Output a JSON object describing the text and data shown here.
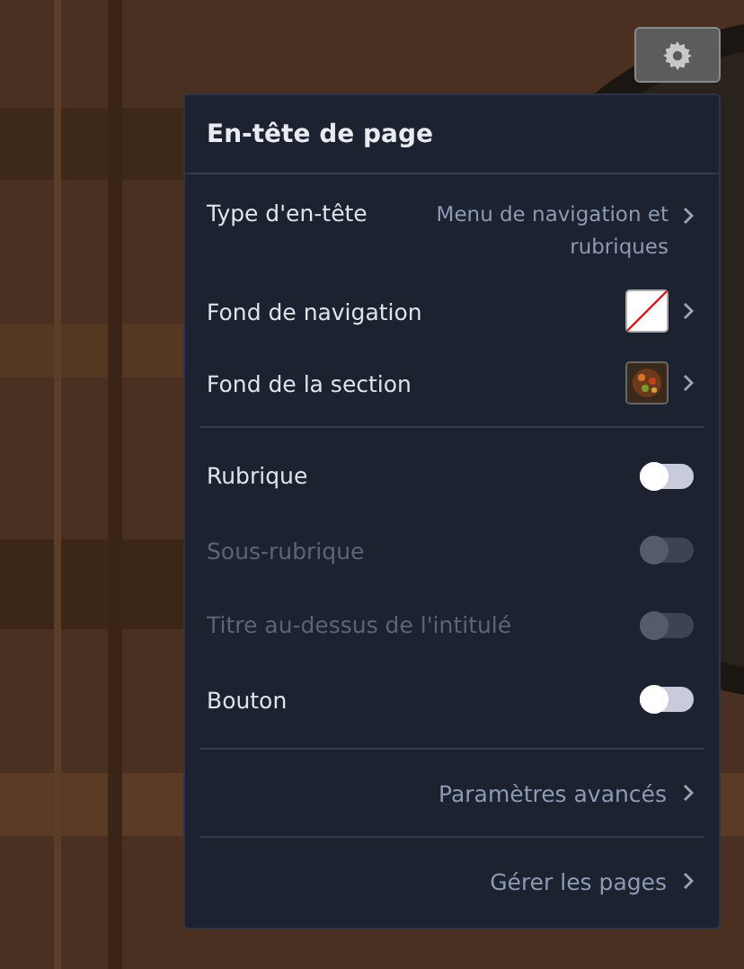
{
  "panel": {
    "title": "En-tête de page",
    "settings": [
      {
        "kind": "value",
        "label": "Type d'en-tête",
        "value": "Menu de navigation et rubriques"
      },
      {
        "kind": "empty_swatch",
        "label": "Fond de navigation"
      },
      {
        "kind": "image_swatch",
        "label": "Fond de la section"
      }
    ],
    "toggles": [
      {
        "label": "Rubrique",
        "on": false,
        "disabled": false
      },
      {
        "label": "Sous-rubrique",
        "on": false,
        "disabled": true
      },
      {
        "label": "Titre au-dessus de l'intitulé",
        "on": false,
        "disabled": true
      },
      {
        "label": "Bouton",
        "on": false,
        "disabled": false
      }
    ],
    "links": [
      "Paramètres avancés",
      "Gérer les pages"
    ]
  }
}
